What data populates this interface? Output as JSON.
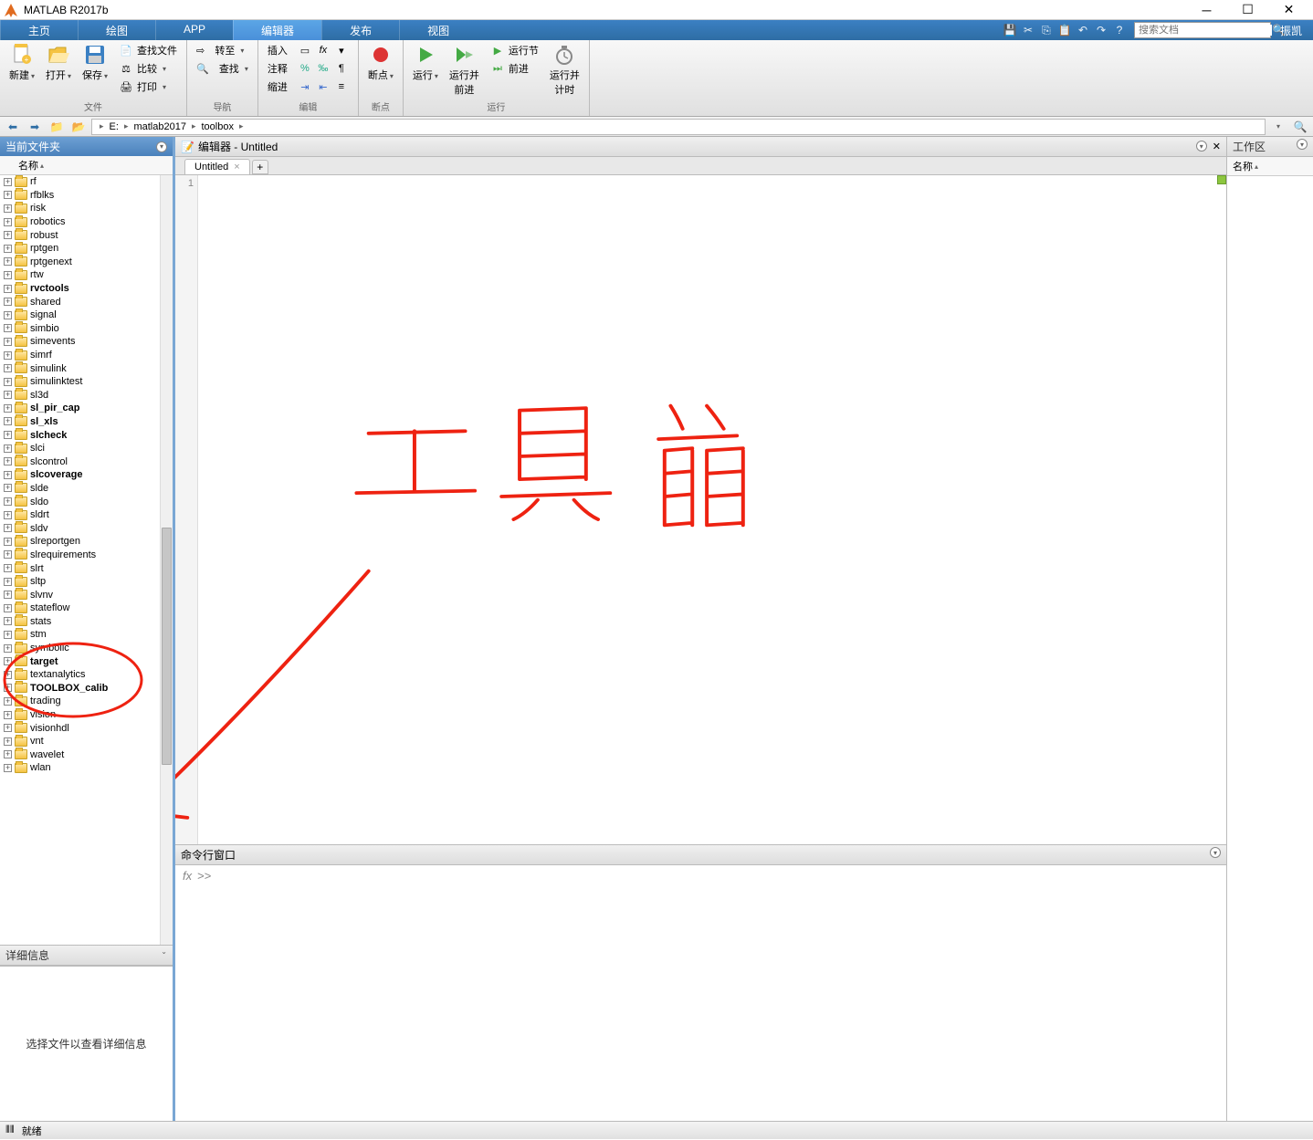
{
  "titlebar": {
    "app_name": "MATLAB R2017b"
  },
  "ribbon": {
    "tabs": [
      "主页",
      "绘图",
      "APP",
      "编辑器",
      "发布",
      "视图"
    ],
    "active_index": 3,
    "search_placeholder": "搜索文档",
    "user": "振凯"
  },
  "toolstrip": {
    "groups": [
      {
        "label": "文件",
        "large": [
          {
            "name": "new-button",
            "text": "新建"
          },
          {
            "name": "open-button",
            "text": "打开"
          },
          {
            "name": "save-button",
            "text": "保存"
          }
        ],
        "small": [
          {
            "name": "find-files",
            "text": "查找文件"
          },
          {
            "name": "compare",
            "text": "比较"
          },
          {
            "name": "print",
            "text": "打印"
          }
        ]
      },
      {
        "label": "导航",
        "small_rows": [
          {
            "name": "goto",
            "text": "转至"
          },
          {
            "name": "find",
            "text": "查找"
          }
        ]
      },
      {
        "label": "编辑",
        "col1": [
          {
            "name": "insert",
            "text": "插入"
          },
          {
            "name": "comment",
            "text": "注释"
          },
          {
            "name": "indent",
            "text": "缩进"
          }
        ]
      },
      {
        "label": "断点",
        "large": [
          {
            "name": "breakpoints",
            "text": "断点"
          }
        ]
      },
      {
        "label": "运行",
        "large": [
          {
            "name": "run",
            "text": "运行"
          },
          {
            "name": "run-advance",
            "text": "运行并\n前进"
          },
          {
            "name": "run-section",
            "text": "运行节"
          },
          {
            "name": "advance",
            "text": "前进"
          },
          {
            "name": "run-time",
            "text": "运行并\n计时"
          }
        ]
      }
    ]
  },
  "path": {
    "segments": [
      "E:",
      "matlab2017",
      "toolbox"
    ]
  },
  "left_panel": {
    "title": "当前文件夹",
    "col_header": "名称",
    "details_title": "详细信息",
    "details_msg": "选择文件以查看详细信息",
    "files": [
      {
        "name": "rf",
        "bold": false
      },
      {
        "name": "rfblks",
        "bold": false
      },
      {
        "name": "risk",
        "bold": false
      },
      {
        "name": "robotics",
        "bold": false
      },
      {
        "name": "robust",
        "bold": false
      },
      {
        "name": "rptgen",
        "bold": false
      },
      {
        "name": "rptgenext",
        "bold": false
      },
      {
        "name": "rtw",
        "bold": false
      },
      {
        "name": "rvctools",
        "bold": true
      },
      {
        "name": "shared",
        "bold": false
      },
      {
        "name": "signal",
        "bold": false
      },
      {
        "name": "simbio",
        "bold": false
      },
      {
        "name": "simevents",
        "bold": false
      },
      {
        "name": "simrf",
        "bold": false
      },
      {
        "name": "simulink",
        "bold": false
      },
      {
        "name": "simulinktest",
        "bold": false
      },
      {
        "name": "sl3d",
        "bold": false
      },
      {
        "name": "sl_pir_cap",
        "bold": true
      },
      {
        "name": "sl_xls",
        "bold": true
      },
      {
        "name": "slcheck",
        "bold": true
      },
      {
        "name": "slci",
        "bold": false
      },
      {
        "name": "slcontrol",
        "bold": false
      },
      {
        "name": "slcoverage",
        "bold": true
      },
      {
        "name": "slde",
        "bold": false
      },
      {
        "name": "sldo",
        "bold": false
      },
      {
        "name": "sldrt",
        "bold": false
      },
      {
        "name": "sldv",
        "bold": false
      },
      {
        "name": "slreportgen",
        "bold": false
      },
      {
        "name": "slrequirements",
        "bold": false
      },
      {
        "name": "slrt",
        "bold": false
      },
      {
        "name": "sltp",
        "bold": false
      },
      {
        "name": "slvnv",
        "bold": false
      },
      {
        "name": "stateflow",
        "bold": false
      },
      {
        "name": "stats",
        "bold": false
      },
      {
        "name": "stm",
        "bold": false
      },
      {
        "name": "symbolic",
        "bold": false
      },
      {
        "name": "target",
        "bold": true
      },
      {
        "name": "textanalytics",
        "bold": false
      },
      {
        "name": "TOOLBOX_calib",
        "bold": true
      },
      {
        "name": "trading",
        "bold": false
      },
      {
        "name": "vision",
        "bold": false
      },
      {
        "name": "visionhdl",
        "bold": false
      },
      {
        "name": "vnt",
        "bold": false
      },
      {
        "name": "wavelet",
        "bold": false
      },
      {
        "name": "wlan",
        "bold": false
      }
    ]
  },
  "editor": {
    "header": "编辑器 - Untitled",
    "tab": "Untitled",
    "line_number": "1"
  },
  "command": {
    "header": "命令行窗口",
    "prompt": ">>"
  },
  "workspace": {
    "title": "工作区",
    "col_header": "名称"
  },
  "status": {
    "ready": "就绪"
  },
  "annotation": {
    "text": "工具箱"
  }
}
